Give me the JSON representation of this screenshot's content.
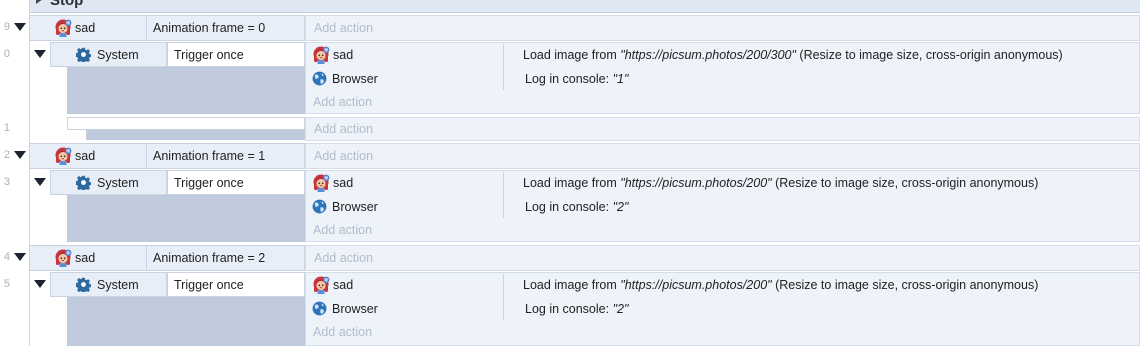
{
  "header": {
    "group_title": "Stop"
  },
  "icons": {
    "object": "girl-sprite-icon",
    "system": "gear-icon",
    "browser": "globe-icon",
    "expand": "triangle-down-icon"
  },
  "line_numbers": [
    "9",
    "0",
    "1",
    "2",
    "3",
    "4",
    "5"
  ],
  "blocks": [
    {
      "event_object": "sad",
      "event_condition": "Animation frame = 0",
      "event_add_action": "Add action",
      "sub_object": "System",
      "sub_condition": "Trigger once",
      "actions": [
        {
          "object": "sad",
          "text_prefix": "Load image from ",
          "text_string": "\"https://picsum.photos/200/300\"",
          "text_suffix": " (Resize to image size, cross-origin anonymous)"
        },
        {
          "object": "Browser",
          "text_prefix": "Log in console: ",
          "text_string": "\"1\"",
          "text_suffix": ""
        }
      ],
      "sub_add_action": "Add action",
      "empty_add_action": "Add action"
    },
    {
      "event_object": "sad",
      "event_condition": "Animation frame = 1",
      "event_add_action": "Add action",
      "sub_object": "System",
      "sub_condition": "Trigger once",
      "actions": [
        {
          "object": "sad",
          "text_prefix": "Load image from ",
          "text_string": "\"https://picsum.photos/200\"",
          "text_suffix": " (Resize to image size, cross-origin anonymous)"
        },
        {
          "object": "Browser",
          "text_prefix": "Log in console: ",
          "text_string": "\"2\"",
          "text_suffix": ""
        }
      ],
      "sub_add_action": "Add action"
    },
    {
      "event_object": "sad",
      "event_condition": "Animation frame = 2",
      "event_add_action": "Add action",
      "sub_object": "System",
      "sub_condition": "Trigger once",
      "actions": [
        {
          "object": "sad",
          "text_prefix": "Load image from ",
          "text_string": "\"https://picsum.photos/200\"",
          "text_suffix": " (Resize to image size, cross-origin anonymous)"
        },
        {
          "object": "Browser",
          "text_prefix": "Log in console: ",
          "text_string": "\"2\"",
          "text_suffix": ""
        }
      ],
      "sub_add_action": "Add action"
    }
  ]
}
